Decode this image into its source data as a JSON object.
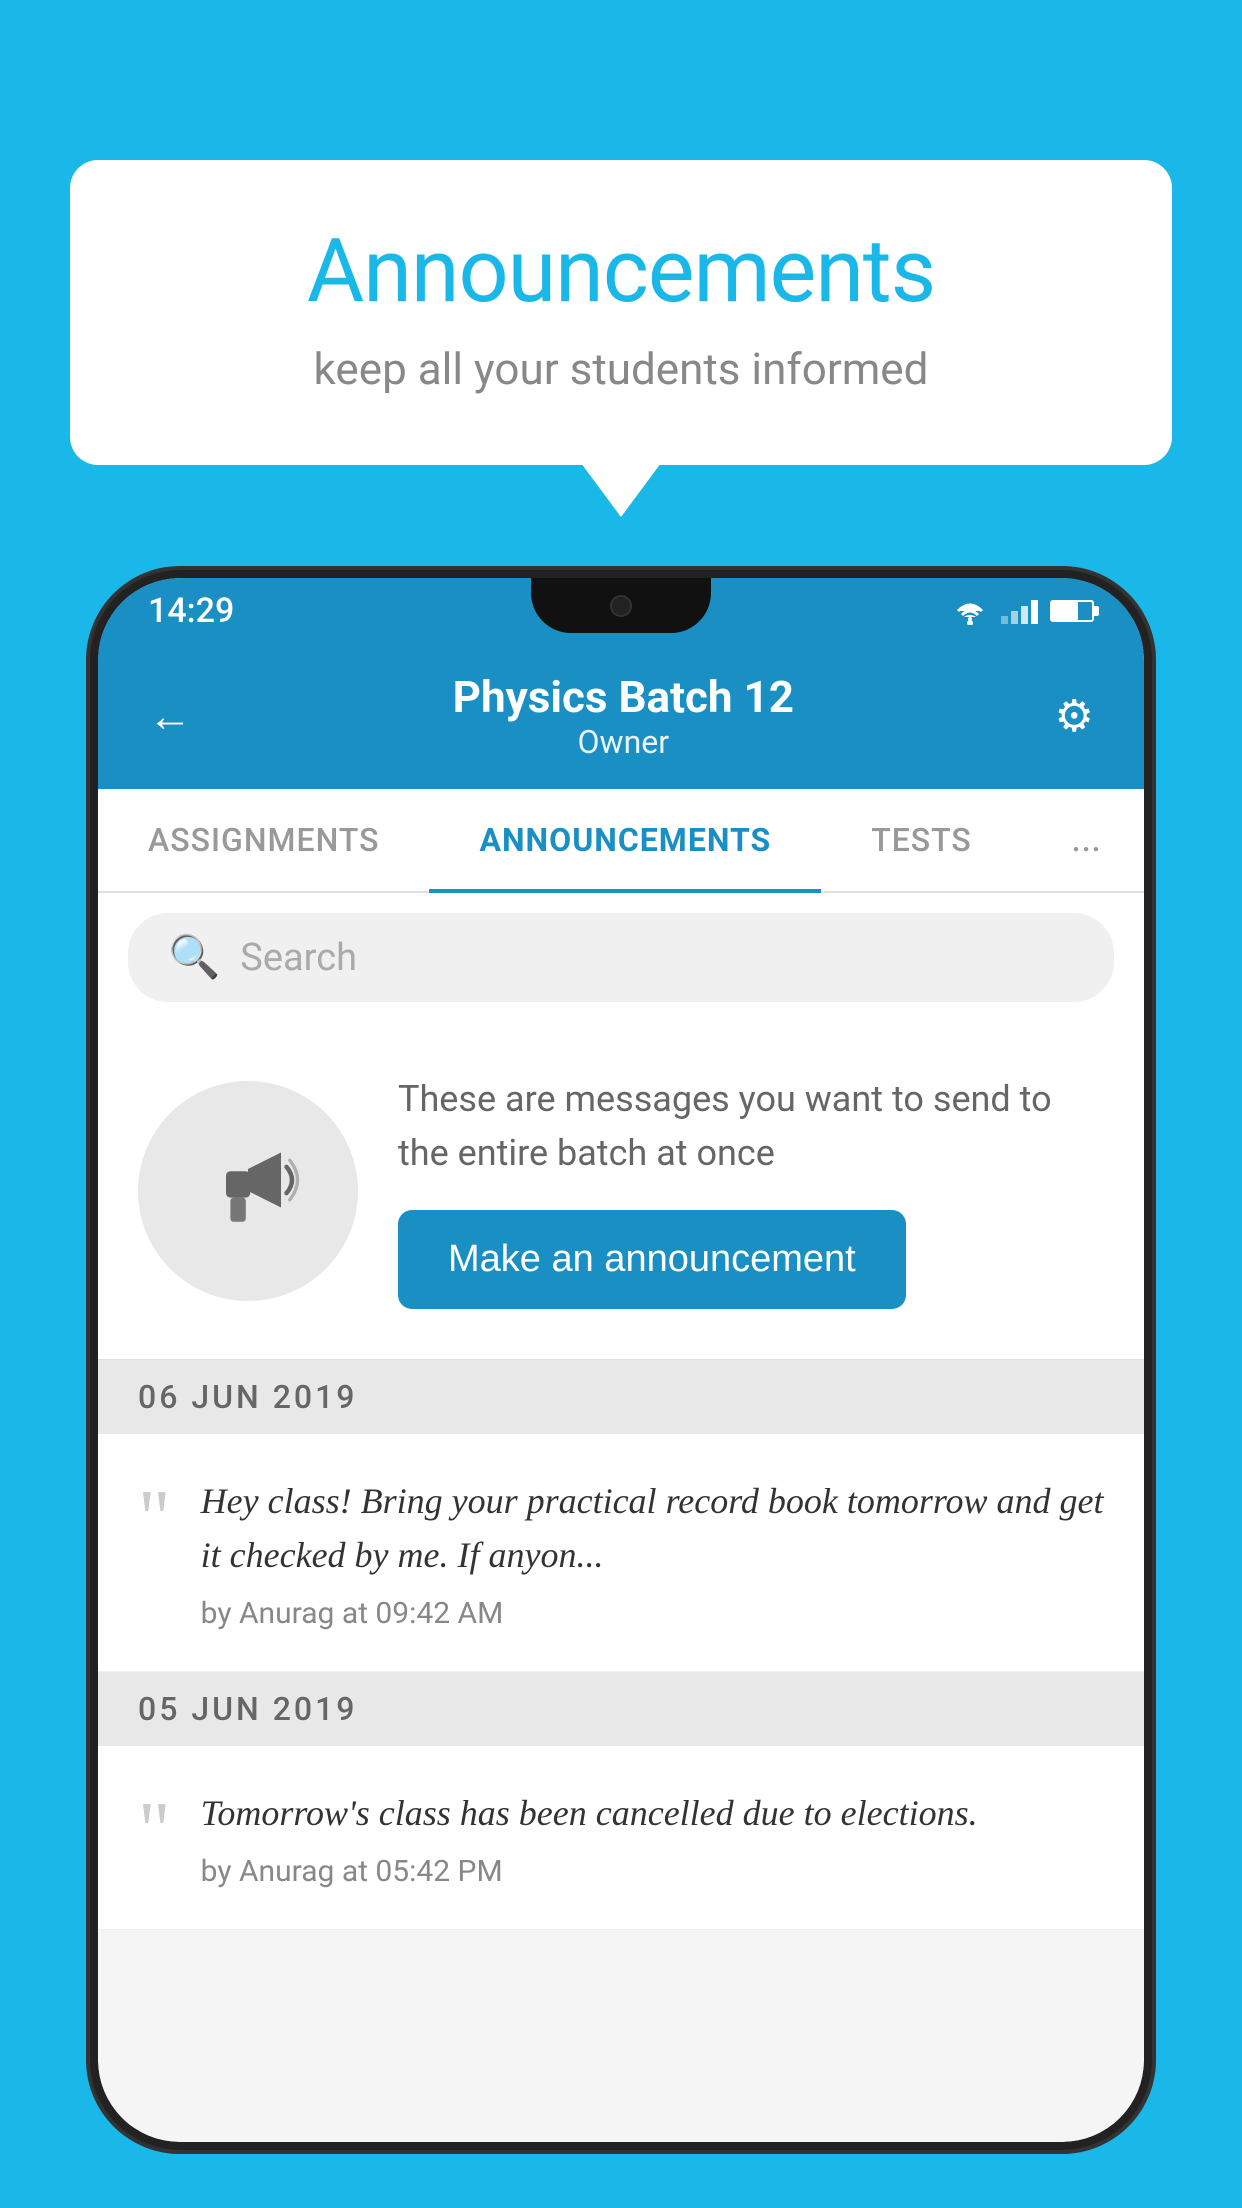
{
  "page": {
    "background_color": "#1ab8e8"
  },
  "speech_bubble": {
    "title": "Announcements",
    "subtitle": "keep all your students informed"
  },
  "phone": {
    "status_bar": {
      "time": "14:29"
    },
    "header": {
      "title": "Physics Batch 12",
      "subtitle": "Owner",
      "back_label": "←",
      "gear_label": "⚙"
    },
    "tabs": [
      {
        "label": "ASSIGNMENTS",
        "active": false
      },
      {
        "label": "ANNOUNCEMENTS",
        "active": true
      },
      {
        "label": "TESTS",
        "active": false
      },
      {
        "label": "...",
        "active": false
      }
    ],
    "search": {
      "placeholder": "Search"
    },
    "promo": {
      "description": "These are messages you want to send to the entire batch at once",
      "button_label": "Make an announcement"
    },
    "announcements": [
      {
        "date": "06  JUN  2019",
        "text": "Hey class! Bring your practical record book tomorrow and get it checked by me. If anyon...",
        "meta": "by Anurag at 09:42 AM"
      },
      {
        "date": "05  JUN  2019",
        "text": "Tomorrow's class has been cancelled due to elections.",
        "meta": "by Anurag at 05:42 PM"
      }
    ]
  }
}
